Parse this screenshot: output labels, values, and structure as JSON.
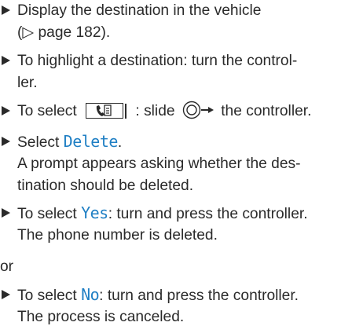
{
  "colors": {
    "text": "#2a2a2a",
    "highlight": "#1f7fc4"
  },
  "icons": {
    "bullet": "right-triangle-bullet-icon",
    "address_book_button": "address-book-button-icon",
    "controller": "controller-slide-right-icon"
  },
  "steps": [
    {
      "line1": "Display the destination in the vehicle",
      "line2": "(▷ page 182)."
    },
    {
      "line1": "To highlight a destination: turn the control-",
      "line2": "ler."
    },
    {
      "prefix": "To select",
      "middle": ": slide",
      "suffix": "the controller."
    },
    {
      "prefix": "Select",
      "highlight": "Delete",
      "suffix": ".",
      "line2": "A prompt appears asking whether the des-",
      "line3": "tination should be deleted."
    },
    {
      "prefix": "To select",
      "highlight": "Yes",
      "suffix": ": turn and press the controller.",
      "line2": "The phone number is deleted."
    },
    {
      "prefix": "To select",
      "highlight": "No",
      "suffix": ": turn and press the controller.",
      "line2": "The process is canceled."
    }
  ],
  "connector": "or"
}
